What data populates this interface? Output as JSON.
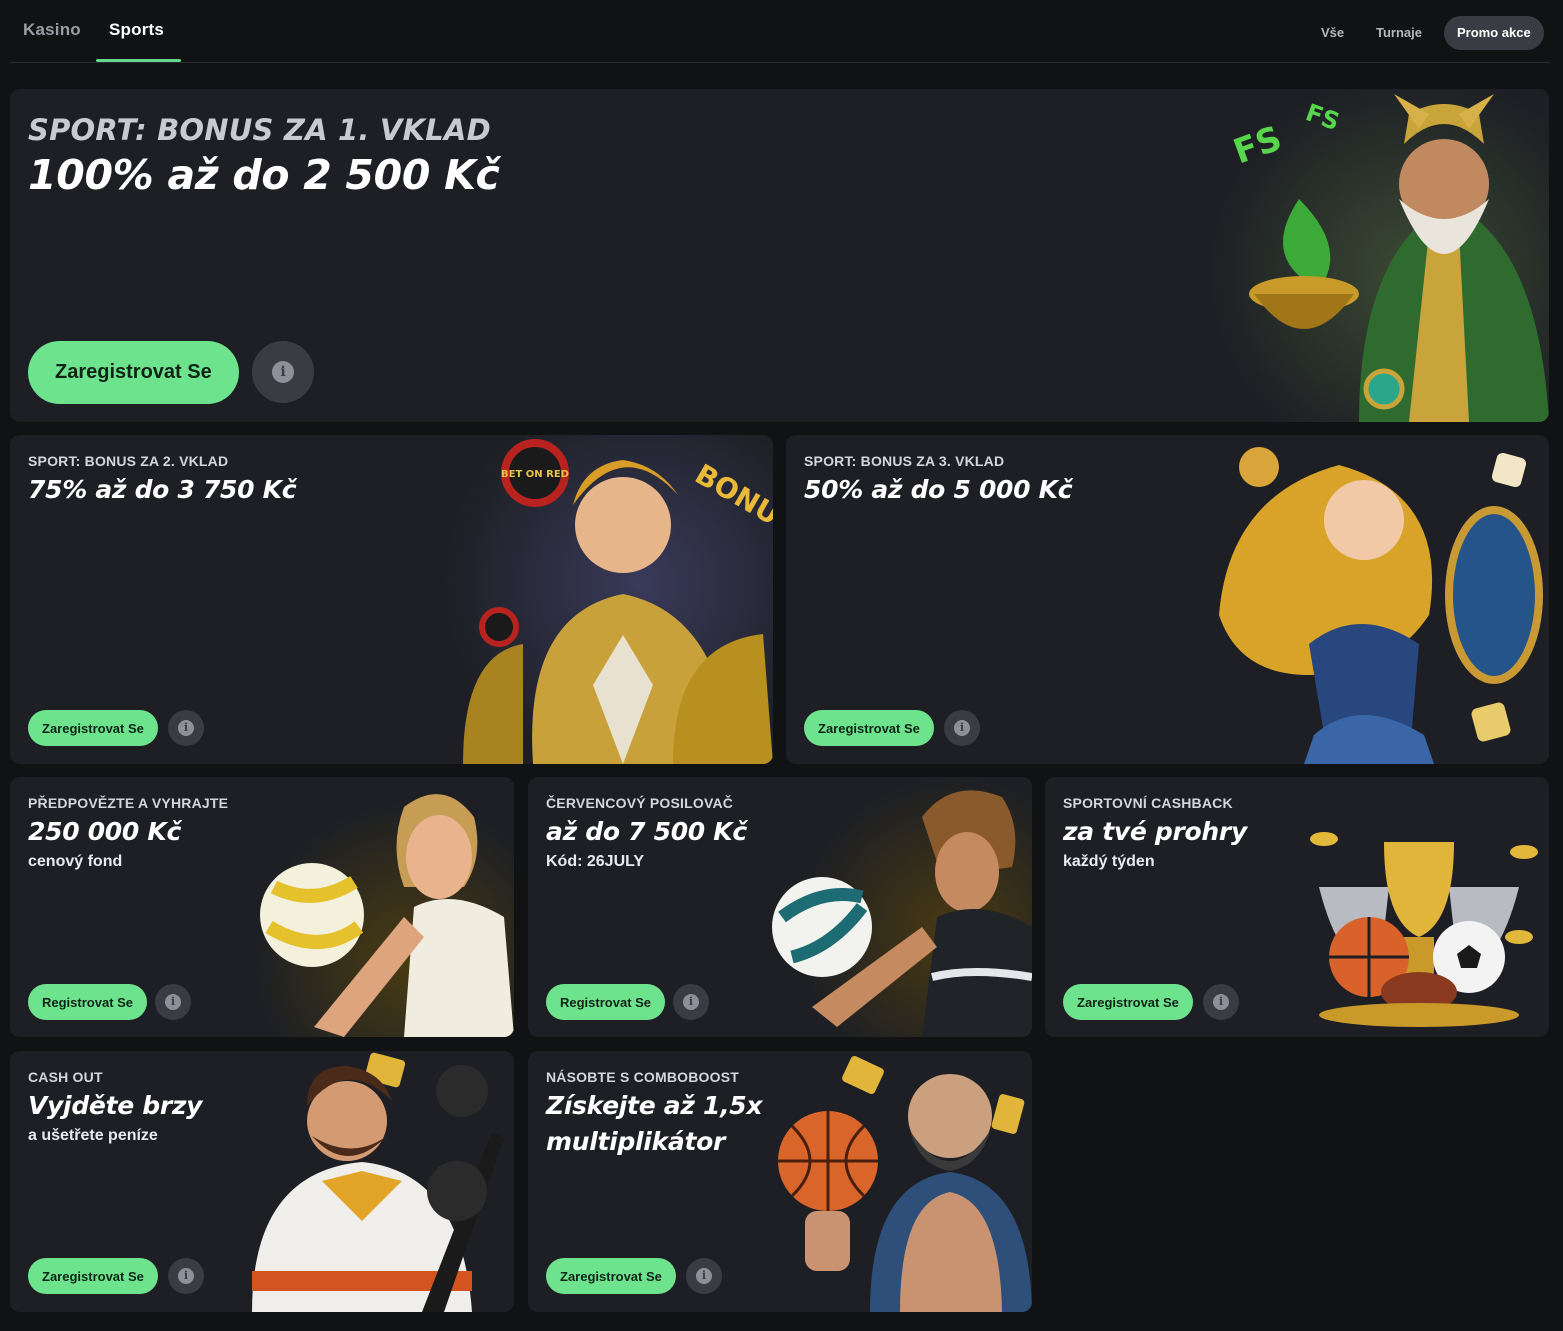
{
  "nav": {
    "main_tabs": [
      {
        "label": "Kasino"
      },
      {
        "label": "Sports"
      }
    ],
    "filters": [
      {
        "label": "Vše"
      },
      {
        "label": "Turnaje"
      },
      {
        "label": "Promo akce"
      }
    ]
  },
  "info_glyph": "i",
  "promos": {
    "p1": {
      "eyebrow": "SPORT: BONUS ZA 1. VKLAD",
      "headline": "100% až do 2 500 Kč",
      "button": "Zaregistrovat Se"
    },
    "p2": {
      "eyebrow": "SPORT: BONUS ZA 2. VKLAD",
      "headline": "75% až do 3 750 Kč",
      "button": "Zaregistrovat Se"
    },
    "p3": {
      "eyebrow": "SPORT: BONUS ZA 3. VKLAD",
      "headline": "50% až do 5 000 Kč",
      "button": "Zaregistrovat Se"
    },
    "p4": {
      "eyebrow": "PŘEDPOVĚZTE A VYHRAJTE",
      "headline": "250 000 Kč",
      "subline": "cenový fond",
      "button": "Registrovat Se"
    },
    "p5": {
      "eyebrow": "ČERVENCOVÝ POSILOVAČ",
      "headline": "až do 7 500 Kč",
      "subline": "Kód: 26JULY",
      "button": "Registrovat Se"
    },
    "p6": {
      "eyebrow": "SPORTOVNÍ CASHBACK",
      "headline": "za tvé prohry",
      "subline": "každý týden",
      "button": "Zaregistrovat Se"
    },
    "p7": {
      "eyebrow": "CASH OUT",
      "headline": "Vyjděte brzy",
      "subline": "a ušetřete peníze",
      "button": "Zaregistrovat Se"
    },
    "p8": {
      "eyebrow": "NÁSOBTE S COMBOBOOST",
      "headline_line1": "Získejte až 1,5x",
      "headline_line2": "multiplikátor",
      "button": "Zaregistrovat Se"
    }
  },
  "art_text": {
    "fs_badge": "FS",
    "bonus_word": "BONUS",
    "chip_text": "BET ON RED"
  },
  "colors": {
    "accent": "#6de38e",
    "card": "#1d1f24",
    "background": "#111214"
  }
}
